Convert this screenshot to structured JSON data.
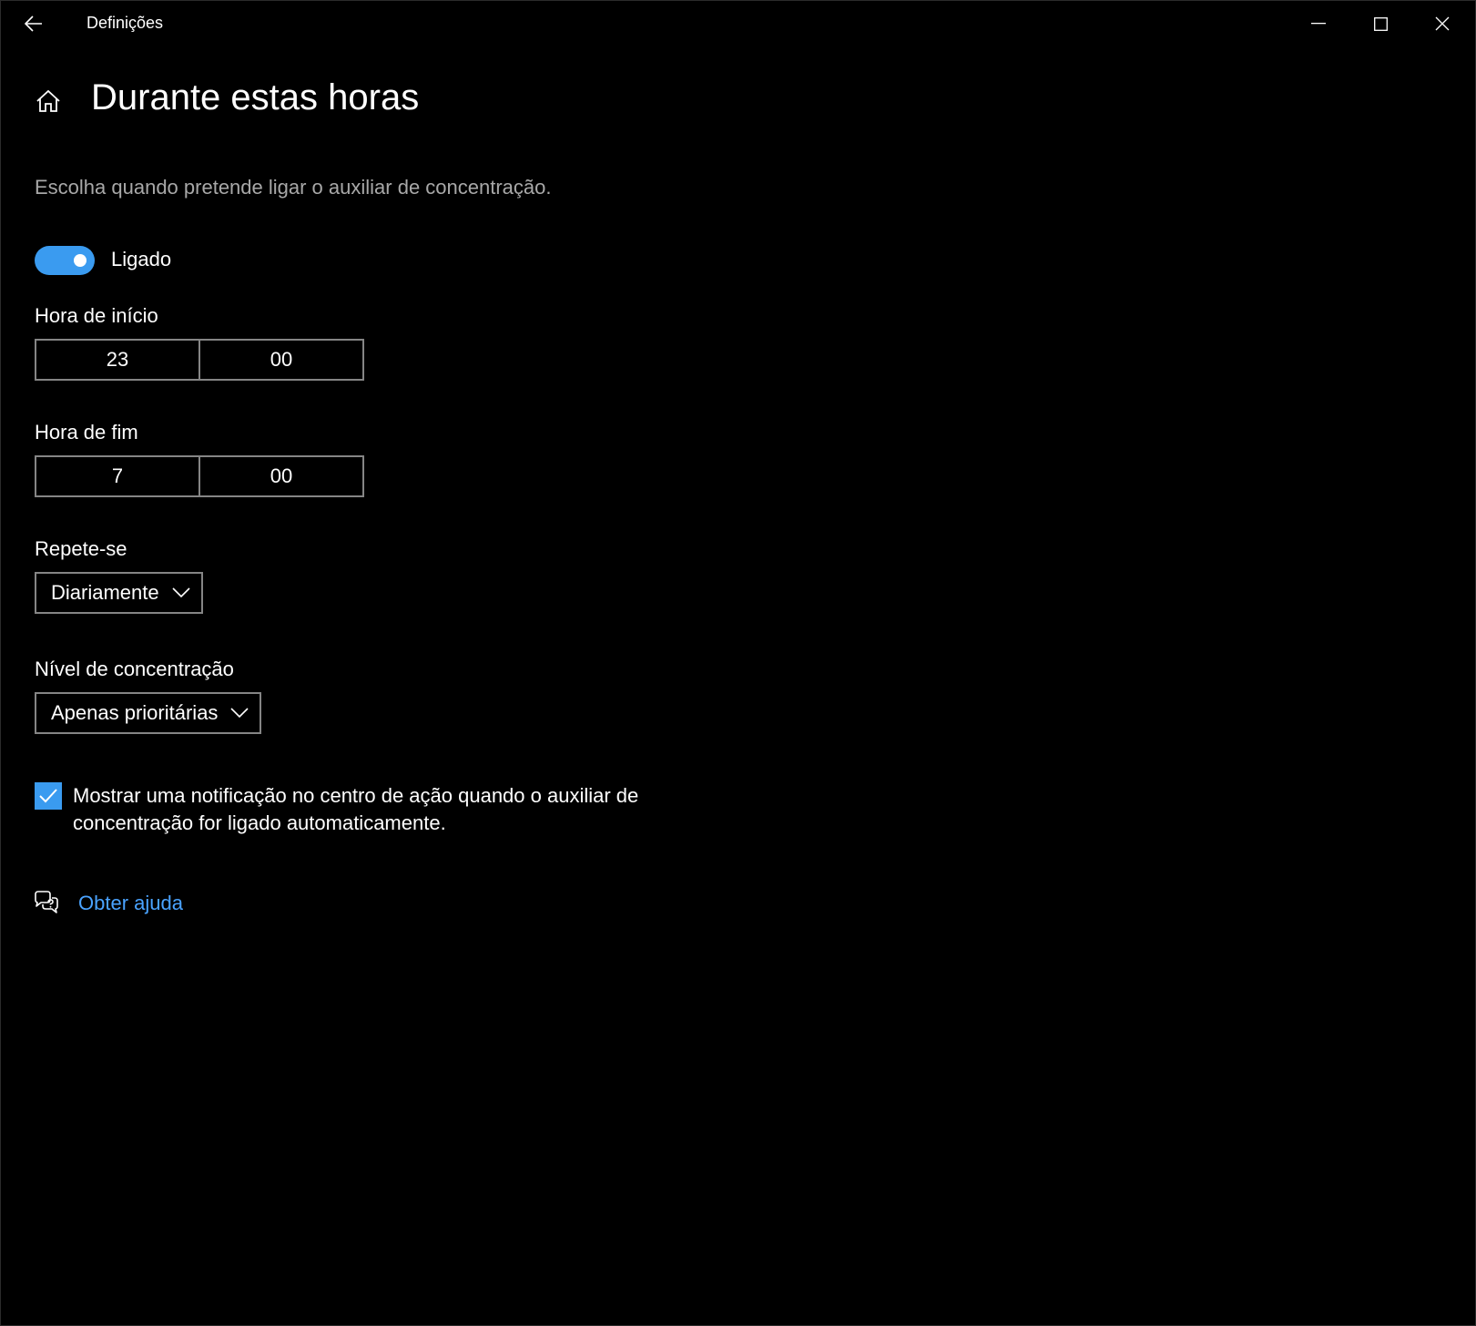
{
  "window": {
    "app_title": "Definições"
  },
  "header": {
    "title": "Durante estas horas",
    "description": "Escolha quando pretende ligar o auxiliar de concentração."
  },
  "toggle": {
    "state": "on",
    "label": "Ligado"
  },
  "start_time": {
    "label": "Hora de início",
    "hour": "23",
    "minute": "00"
  },
  "end_time": {
    "label": "Hora de fim",
    "hour": "7",
    "minute": "00"
  },
  "repeat": {
    "label": "Repete-se",
    "selected": "Diariamente"
  },
  "focus_level": {
    "label": "Nível de concentração",
    "selected": "Apenas prioritárias"
  },
  "notification_checkbox": {
    "checked": true,
    "label": "Mostrar uma notificação no centro de ação quando o auxiliar de concentração for ligado automaticamente."
  },
  "help": {
    "link_label": "Obter ajuda"
  },
  "colors": {
    "accent": "#3a9bf0",
    "link": "#4aa3ff",
    "background": "#000000",
    "border": "#858585",
    "secondary_text": "#a8a8a8"
  },
  "icons": {
    "back": "back-arrow-icon",
    "home": "home-icon",
    "minimize": "minimize-icon",
    "maximize": "maximize-icon",
    "close": "close-icon",
    "dropdown": "chevron-down-icon",
    "check": "checkmark-icon",
    "help": "help-chat-icon"
  }
}
